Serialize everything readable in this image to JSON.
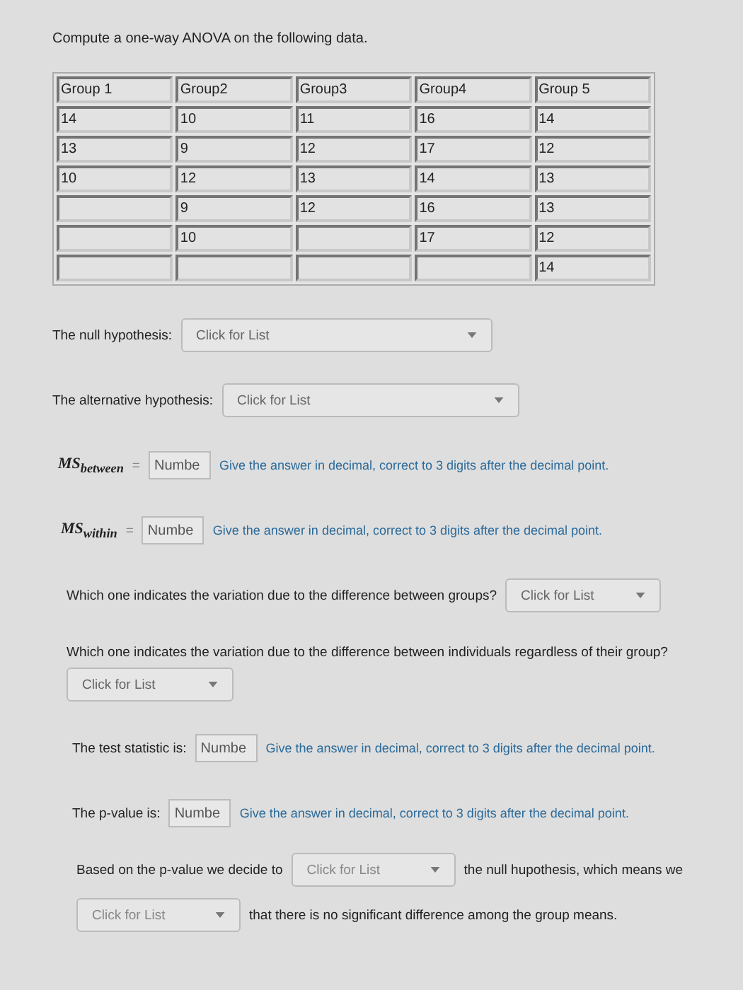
{
  "prompt": "Compute a one-way ANOVA on the following data.",
  "table": {
    "columns": [
      {
        "header": "Group 1",
        "values": [
          "14",
          "13",
          "10"
        ]
      },
      {
        "header": "Group2",
        "values": [
          "10",
          "9",
          "12",
          "9",
          "10"
        ]
      },
      {
        "header": "Group3",
        "values": [
          "11",
          "12",
          "13",
          "12"
        ]
      },
      {
        "header": "Group4",
        "values": [
          "16",
          "17",
          "14",
          "16",
          "17"
        ]
      },
      {
        "header": "Group 5",
        "values": [
          "14",
          "12",
          "13",
          "13",
          "12",
          "14"
        ]
      }
    ]
  },
  "items": [
    {
      "kind": "select",
      "label": "The null hypothesis:",
      "placeholder": "Click for List"
    },
    {
      "kind": "select",
      "label": "The alternative hypothesis:",
      "placeholder": "Click for List"
    },
    {
      "kind": "math_number",
      "label": "MS$_{between}$",
      "equals": "=",
      "placeholder": "Numbe",
      "hint": "Give the answer in decimal, correct to 3 digits after the decimal point."
    },
    {
      "kind": "math_number",
      "label": "MS$_{within}$",
      "equals": "=",
      "placeholder": "Numbe",
      "hint": "Give the answer in decimal, correct to 3 digits after the decimal point."
    },
    {
      "kind": "select",
      "label": "Which one indicates the variation due to the difference between groups?",
      "placeholder": "Click for List"
    },
    {
      "kind": "select_below",
      "label": "Which one indicates the variation due to the difference between individuals regardless of their group?",
      "placeholder": "Click for List"
    },
    {
      "kind": "number",
      "label": "The test statistic is:",
      "placeholder": "Numbe",
      "hint": "Give the answer in decimal, correct to 3 digits after the decimal point."
    },
    {
      "kind": "number",
      "label": "The p-value is:",
      "placeholder": "Numbe",
      "hint": "Give the answer in decimal, correct to 3 digits after the decimal point."
    },
    {
      "kind": "decision",
      "before": "Based on the p-value we decide to",
      "placeholder": "Click for List",
      "middle": "the null hupothesis, which means we",
      "placeholder2": "Click for List",
      "after": "that there is no significant difference among the group means."
    }
  ]
}
